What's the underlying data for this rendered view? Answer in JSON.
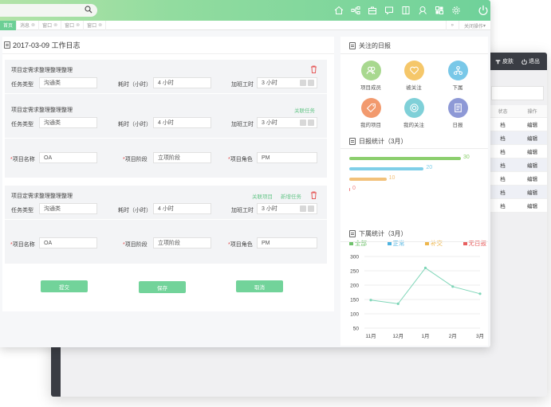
{
  "back_window": {
    "header_skin": "皮肤",
    "header_logout": "退出",
    "table_headers": [
      "状态",
      "操作"
    ],
    "rows": [
      {
        "status": "档",
        "action": "编辑"
      },
      {
        "status": "档",
        "action": "编辑"
      },
      {
        "status": "档",
        "action": "编辑"
      },
      {
        "status": "档",
        "action": "编辑"
      },
      {
        "status": "档",
        "action": "编辑"
      },
      {
        "status": "档",
        "action": "编辑"
      },
      {
        "status": "档",
        "action": "编辑"
      }
    ]
  },
  "tabs": [
    {
      "label": "首页"
    },
    {
      "label": "消息"
    },
    {
      "label": "窗口"
    },
    {
      "label": "窗口"
    },
    {
      "label": "窗口"
    }
  ],
  "tabbar_right": {
    "arrows": "»",
    "close_ops": "关闭操作"
  },
  "work_log": {
    "title": "2017-03-09 工作日志",
    "task1": {
      "title": "项目定需求整理整理整理",
      "type_label": "任务类型",
      "type_value": "沟通类",
      "hours_label": "耗时（小时）",
      "hours_value": "4 小时",
      "overtime_label": "加班工时",
      "overtime_value": "3 小时"
    },
    "task2": {
      "title": "项目定需求整理整理整理",
      "link_task": "关联任务",
      "type_label": "任务类型",
      "type_value": "沟通类",
      "hours_label": "耗时（小时）",
      "hours_value": "4 小时",
      "overtime_label": "加班工时",
      "overtime_value": "3 小时",
      "project_label": "项目名称",
      "project_value": "OA",
      "stage_label": "项目阶段",
      "stage_value": "立项阶段",
      "role_label": "项目角色",
      "role_value": "PM"
    },
    "task3": {
      "title": "项目定需求整理整理整理",
      "link_project": "关联项目",
      "add_task": "新增任务",
      "type_label": "任务类型",
      "type_value": "沟通类",
      "hours_label": "耗时（小时）",
      "hours_value": "4 小时",
      "overtime_label": "加班工时",
      "overtime_value": "3 小时",
      "project_label": "项目名称",
      "project_value": "OA",
      "stage_label": "项目阶段",
      "stage_value": "立项阶段",
      "role_label": "项目角色",
      "role_value": "PM"
    },
    "buttons": {
      "submit": "提交",
      "save": "保存",
      "cancel": "取消"
    }
  },
  "sidebar": {
    "followed_title": "关注的日报",
    "shortcuts": [
      {
        "label": "项目成员",
        "icon": "members-icon",
        "color": "#a8d88f"
      },
      {
        "label": "被关注",
        "icon": "heart-icon",
        "color": "#f5c76a"
      },
      {
        "label": "下属",
        "icon": "org-icon",
        "color": "#79c8e8"
      },
      {
        "label": "我的项目",
        "icon": "tag-icon",
        "color": "#f29a6e"
      },
      {
        "label": "我的关注",
        "icon": "target-icon",
        "color": "#7fd0d8"
      },
      {
        "label": "日报",
        "icon": "report-icon",
        "color": "#8e99d6"
      }
    ],
    "daily_stats_title": "日报统计（3月）",
    "daily_stats": [
      {
        "value": 30,
        "color": "#8ccf6e"
      },
      {
        "value": 20,
        "color": "#7fcfe8"
      },
      {
        "value": 10,
        "color": "#f2c17a"
      },
      {
        "value": 0,
        "color": "#f08080"
      }
    ],
    "daily_stats_labels": [
      "30",
      "20",
      "10",
      "0"
    ],
    "legend": [
      {
        "label": "全部",
        "color": "#6fc26c"
      },
      {
        "label": "正常",
        "color": "#4eb3e0"
      },
      {
        "label": "补交",
        "color": "#eeb64c"
      },
      {
        "label": "无日报",
        "color": "#e86060"
      }
    ],
    "sub_stats_title": "下属统计（3月）"
  },
  "chart_data": {
    "type": "line",
    "x": [
      "11月",
      "12月",
      "1月",
      "2月",
      "3月"
    ],
    "series": [
      {
        "values": [
          148,
          135,
          260,
          195,
          170
        ]
      }
    ],
    "yticks": [
      "300",
      "250",
      "200",
      "150",
      "100",
      "50"
    ],
    "ylim": [
      50,
      300
    ],
    "grid": true,
    "color": "#7fd6b8"
  }
}
